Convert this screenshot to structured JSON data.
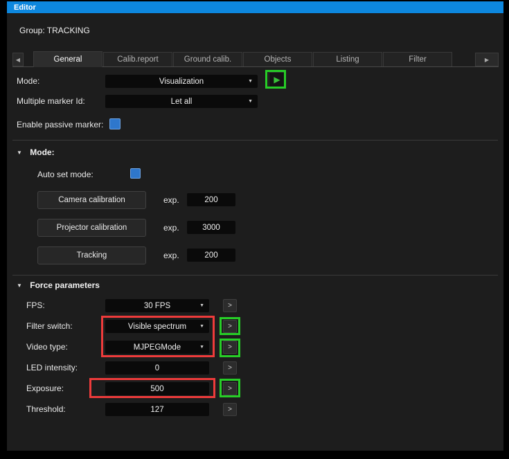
{
  "titlebar": {
    "title": "Editor"
  },
  "header": {
    "group_label": "Group: TRACKING"
  },
  "icons": {
    "chevron_down": "▼",
    "section_expanded": "▼",
    "scroll_left": "◀",
    "scroll_right": "▶",
    "play": "▶"
  },
  "tabs": {
    "items": [
      {
        "label": "General",
        "active": true
      },
      {
        "label": "Calib.report",
        "active": false
      },
      {
        "label": "Ground calib.",
        "active": false
      },
      {
        "label": "Objects",
        "active": false
      },
      {
        "label": "Listing",
        "active": false
      },
      {
        "label": "Filter",
        "active": false
      }
    ]
  },
  "top_form": {
    "mode": {
      "label": "Mode:",
      "value": "Visualization"
    },
    "multiple_marker": {
      "label": "Multiple marker Id:",
      "value": "Let all"
    },
    "enable_passive": {
      "label": "Enable passive marker:",
      "checked": true
    }
  },
  "mode_section": {
    "title": "Mode:",
    "auto_set": {
      "label": "Auto set mode:",
      "checked": true
    },
    "exp_label": "exp.",
    "rows": [
      {
        "button": "Camera calibration",
        "exp": "200"
      },
      {
        "button": "Projector calibration",
        "exp": "3000"
      },
      {
        "button": "Tracking",
        "exp": "200"
      }
    ]
  },
  "force_section": {
    "title": "Force parameters",
    "apply_label": ">",
    "rows": [
      {
        "label": "FPS:",
        "type": "dropdown",
        "value": "30 FPS"
      },
      {
        "label": "Filter switch:",
        "type": "dropdown",
        "value": "Visible spectrum"
      },
      {
        "label": "Video type:",
        "type": "dropdown",
        "value": "MJPEGMode"
      },
      {
        "label": "LED intensity:",
        "type": "input",
        "value": "0"
      },
      {
        "label": "Exposure:",
        "type": "input",
        "value": "500"
      },
      {
        "label": "Threshold:",
        "type": "input",
        "value": "127"
      }
    ]
  },
  "colors": {
    "titlebar": "#0d87de",
    "checkbox": "#2e77cc",
    "red": "#ee3b3b",
    "green": "#27cd27"
  }
}
